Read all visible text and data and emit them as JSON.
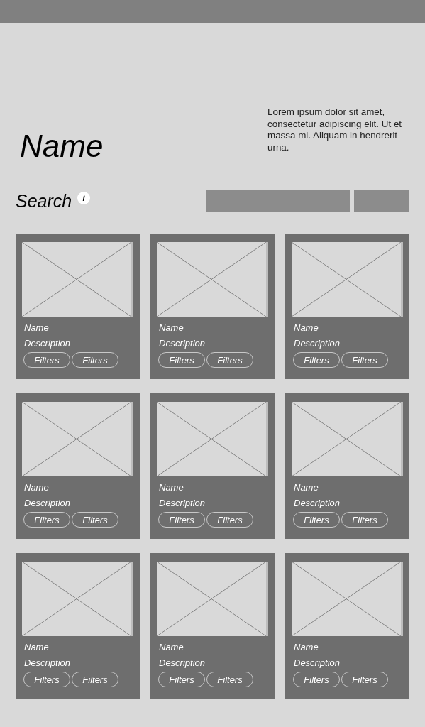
{
  "header": {
    "title": "Name",
    "description": "Lorem ipsum dolor sit amet, consectetur adipiscing elit. Ut et massa mi. Aliquam in hendrerit urna."
  },
  "search": {
    "label": "Search",
    "info_icon": "i"
  },
  "cards": [
    {
      "name": "Name",
      "description": "Description",
      "filters": [
        "Filters",
        "Filters"
      ]
    },
    {
      "name": "Name",
      "description": "Description",
      "filters": [
        "Filters",
        "Filters"
      ]
    },
    {
      "name": "Name",
      "description": "Description",
      "filters": [
        "Filters",
        "Filters"
      ]
    },
    {
      "name": "Name",
      "description": "Description",
      "filters": [
        "Filters",
        "Filters"
      ]
    },
    {
      "name": "Name",
      "description": "Description",
      "filters": [
        "Filters",
        "Filters"
      ]
    },
    {
      "name": "Name",
      "description": "Description",
      "filters": [
        "Filters",
        "Filters"
      ]
    },
    {
      "name": "Name",
      "description": "Description",
      "filters": [
        "Filters",
        "Filters"
      ]
    },
    {
      "name": "Name",
      "description": "Description",
      "filters": [
        "Filters",
        "Filters"
      ]
    },
    {
      "name": "Name",
      "description": "Description",
      "filters": [
        "Filters",
        "Filters"
      ]
    }
  ]
}
